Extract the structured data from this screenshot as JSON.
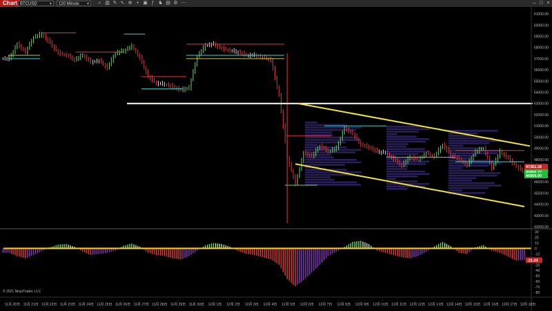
{
  "window": {
    "tab_label": "Chart",
    "instrument": "BTCUSD",
    "timeframe": "120 Minute",
    "copyright": "© 2021 NinjaTrader, LLC"
  },
  "toolbar_icons": [
    "search-icon",
    "bar-style-icon",
    "draw-tool-icon",
    "pointer-icon",
    "zoom-icon",
    "crosshair-icon",
    "lock-icon",
    "indicator-icon",
    "strategy-icon",
    "template-icon",
    "properties-icon",
    "window-more-icon"
  ],
  "price_axis": {
    "ticks": [
      "61000.00",
      "60000.00",
      "59000.00",
      "58000.00",
      "57000.00",
      "56000.00",
      "55000.00",
      "54000.00",
      "53000.00",
      "52000.00",
      "51000.00",
      "50000.00",
      "49000.00",
      "48000.00",
      "47000.00",
      "46000.00",
      "45000.00",
      "44000.00",
      "43000.00",
      "42000.00"
    ],
    "current_price": "46817.26",
    "marker_red": "47362.28",
    "marker_green": "46868.72",
    "marker_green2": "46569.00"
  },
  "osc_axis": {
    "ticks": [
      "30",
      "20",
      "10",
      "0",
      "-10",
      "-20",
      "-30",
      "-40",
      "-50",
      "-60",
      "-70",
      "-80"
    ],
    "current_value": "-21.43"
  },
  "time_axis": {
    "labels": [
      "11月 20日",
      "11月 21日",
      "11月 22日",
      "11月 23日",
      "11月 24日",
      "11月 25日",
      "11月 26日",
      "11月 27日",
      "11月 28日",
      "11月 29日",
      "11月 30日",
      "12月 1日",
      "12月 2日",
      "12月 3日",
      "12月 4日",
      "12月 5日",
      "12月 6日",
      "12月 7日",
      "12月 8日",
      "12月 9日",
      "12月 10日",
      "12月 11日",
      "12月 12日",
      "12月 13日",
      "12月 14日",
      "12月 15日",
      "12月 16日",
      "12月 17日",
      "12月 18日"
    ]
  },
  "colors": {
    "up_bar": "#6fd46f",
    "down_bar": "#e23b3b",
    "neutral_bar": "#d9d9d9",
    "support_line": "#ffffff",
    "channel": "#f2e63a",
    "zero_line": "#ffd400",
    "profile": "#4a3a9e"
  },
  "chart_data": {
    "type": "line",
    "title": "",
    "series": [
      {
        "values": [
          57000,
          58300,
          57600,
          58900,
          59200,
          58400,
          57500,
          57300,
          56900,
          57300,
          56700,
          56800,
          56200,
          57500,
          57700,
          58100,
          57100,
          55400,
          54800,
          54700,
          54500,
          54200,
          54400,
          57200,
          58200,
          58300,
          57900,
          57700,
          57600,
          57300,
          57300,
          57100,
          56900,
          53700,
          48200,
          45800,
          48600,
          48300,
          49200,
          48700,
          49000,
          50800,
          50300,
          49300,
          49100,
          48700,
          48600,
          48000,
          47500,
          48200,
          48000,
          48500,
          48300,
          49300,
          48400,
          48000,
          47500,
          48700,
          49000,
          47200,
          48700,
          48100,
          47400,
          46800
        ]
      }
    ],
    "levels": [
      53000
    ],
    "channel_upper": {
      "x": [
        "12月 5日",
        "12月 18日"
      ],
      "y": [
        53000,
        49200
      ]
    },
    "channel_lower": {
      "x": [
        "12月 5日",
        "12月 18日"
      ],
      "y": [
        47600,
        43800
      ]
    },
    "ylim": [
      42000,
      61500
    ],
    "oscillator": {
      "values": [
        -8,
        -14,
        -18,
        -12,
        -5,
        2,
        7,
        8,
        3,
        -6,
        -12,
        -10,
        -8,
        -4,
        5,
        9,
        3,
        -8,
        -12,
        -14,
        -18,
        -20,
        -14,
        -4,
        6,
        10,
        8,
        3,
        -5,
        -10,
        -12,
        -16,
        -20,
        -30,
        -56,
        -69,
        -58,
        -44,
        -30,
        -14,
        -6,
        3,
        12,
        14,
        8,
        -4,
        -8,
        -12,
        -16,
        -18,
        -14,
        -6,
        4,
        12,
        4,
        -8,
        -10,
        2,
        6,
        -4,
        -8,
        -15,
        -22,
        -21
      ],
      "ylim": [
        -85,
        32
      ],
      "zero": 0
    }
  }
}
